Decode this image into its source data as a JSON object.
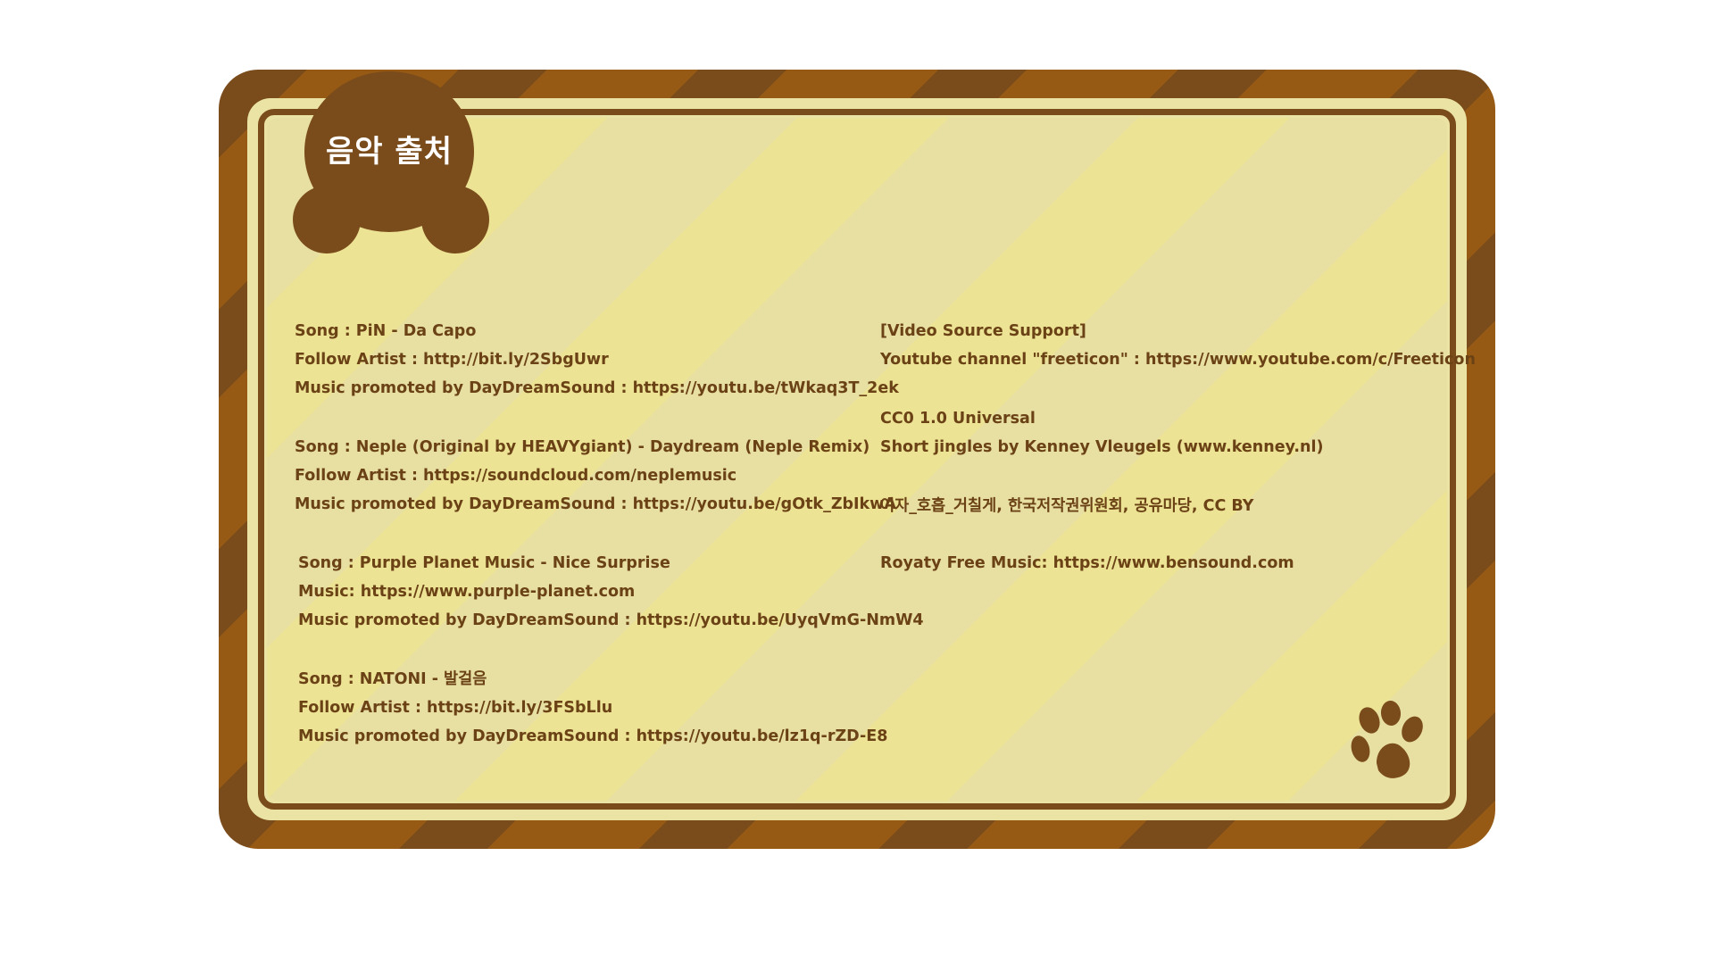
{
  "badge": {
    "title": "음악 출처"
  },
  "left_column": [
    {
      "lines": [
        "Song : PiN - Da Capo",
        "Follow Artist : http://bit.ly/2SbgUwr",
        "Music promoted by DayDreamSound : https://youtu.be/tWkaq3T_2ek"
      ]
    },
    {
      "lines": [
        "Song : Neple (Original by HEAVYgiant) - Daydream (Neple Remix)",
        "Follow Artist : https://soundcloud.com/neplemusic",
        "Music promoted by DayDreamSound : https://youtu.be/gOtk_ZbIkwA"
      ]
    },
    {
      "lines": [
        "Song : Purple Planet Music - Nice Surprise",
        "Music: https://www.purple-planet.com",
        "Music promoted by DayDreamSound : https://youtu.be/UyqVmG-NmW4"
      ]
    },
    {
      "lines": [
        "Song : NATONI - 발걸음",
        "Follow Artist : https://bit.ly/3FSbLlu",
        "Music promoted by DayDreamSound : https://youtu.be/lz1q-rZD-E8"
      ]
    }
  ],
  "right_column": [
    {
      "lines": [
        "[Video Source Support]",
        "Youtube channel \"freeticon\" : https://www.youtube.com/c/Freeticon"
      ]
    },
    {
      "lines": [
        "CC0 1.0 Universal",
        "Short jingles by Kenney Vleugels (www.kenney.nl)"
      ]
    },
    {
      "lines": [
        "여자_호흡_거칠게, 한국저작권위원회, 공유마당, CC BY"
      ]
    },
    {
      "lines": [
        "Royaty Free Music: https://www.bensound.com"
      ]
    }
  ],
  "colors": {
    "frame_dark": "#7a4b1b",
    "frame_light": "#965a14",
    "panel_light": "#e8dfa3",
    "panel_yellow": "#ede395",
    "text": "#6b4215"
  },
  "icons": {
    "corner": "paw-print-icon"
  }
}
